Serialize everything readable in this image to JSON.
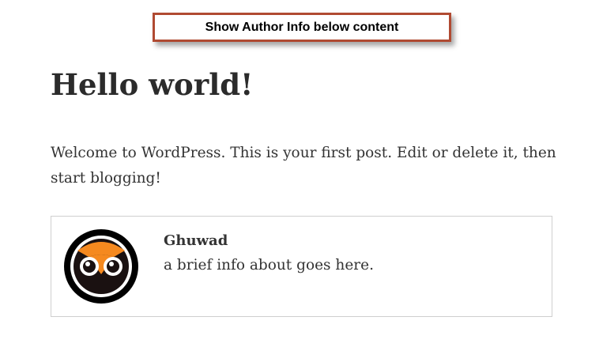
{
  "callout": {
    "label": "Show Author Info below content"
  },
  "post": {
    "title": "Hello world!",
    "content": "Welcome to WordPress. This is your first post. Edit or delete it, then start blogging!"
  },
  "author_box": {
    "name": "Ghuwad",
    "bio": "a brief info about goes here.",
    "avatar_icon": "owl-avatar-icon",
    "avatar_colors": {
      "ring": "#000000",
      "face": "#111111",
      "beak": "#f5891f"
    }
  }
}
